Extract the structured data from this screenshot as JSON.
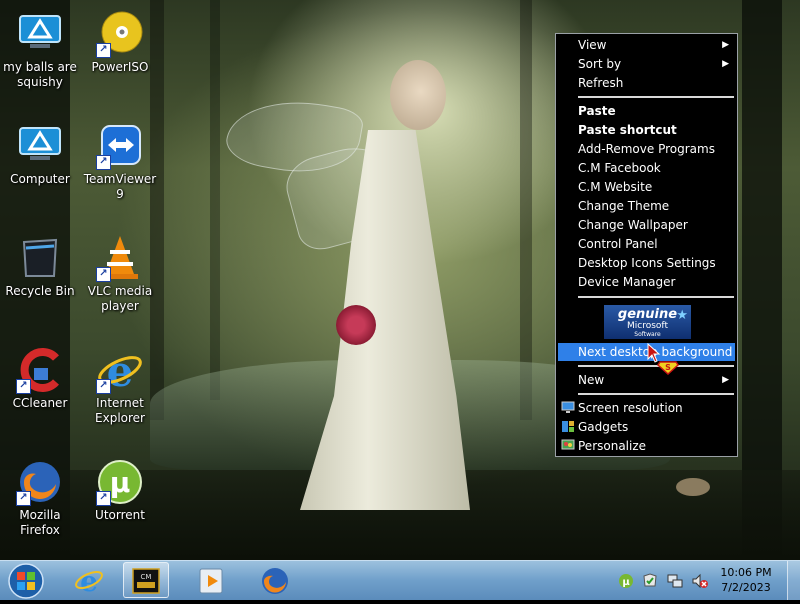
{
  "desktop": {
    "icons": [
      {
        "label": "my balls are squishy",
        "icon": "network-icon"
      },
      {
        "label": "PowerISO",
        "icon": "poweriso-disc-icon"
      },
      {
        "label": "Computer",
        "icon": "computer-icon"
      },
      {
        "label": "TeamViewer 9",
        "icon": "teamviewer-icon"
      },
      {
        "label": "Recycle Bin",
        "icon": "recycle-bin-icon"
      },
      {
        "label": "VLC media player",
        "icon": "vlc-cone-icon"
      },
      {
        "label": "CCleaner",
        "icon": "ccleaner-icon"
      },
      {
        "label": "Internet Explorer",
        "icon": "internet-explorer-icon"
      },
      {
        "label": "Mozilla Firefox",
        "icon": "firefox-icon"
      },
      {
        "label": "Utorrent",
        "icon": "utorrent-icon"
      }
    ]
  },
  "context_menu": {
    "items": [
      {
        "label": "View",
        "submenu": true
      },
      {
        "label": "Sort by",
        "submenu": true
      },
      {
        "label": "Refresh"
      },
      {
        "label": "Paste"
      },
      {
        "label": "Paste shortcut"
      },
      {
        "label": "Add-Remove Programs"
      },
      {
        "label": "C.M Facebook"
      },
      {
        "label": "C.M Website"
      },
      {
        "label": "Change Theme"
      },
      {
        "label": "Change Wallpaper"
      },
      {
        "label": "Control Panel"
      },
      {
        "label": "Desktop Icons Settings"
      },
      {
        "label": "Device Manager"
      },
      {
        "label": "Next desktop background",
        "highlighted": true
      },
      {
        "label": "New",
        "submenu": true
      },
      {
        "label": "Screen resolution",
        "icon": "monitor-icon"
      },
      {
        "label": "Gadgets",
        "icon": "gadgets-icon"
      },
      {
        "label": "Personalize",
        "icon": "personalize-icon"
      }
    ],
    "banner": {
      "line1": "genuine",
      "line2": "Microsoft",
      "line3": "Software"
    }
  },
  "taskbar": {
    "buttons": [
      "start-orb-icon",
      "internet-explorer-icon",
      "cm-app-icon",
      "media-player-icon",
      "firefox-icon"
    ],
    "clock": {
      "time": "10:06 PM",
      "date": "7/2/2023"
    },
    "colors": {
      "accent": "#2f80e8",
      "taskbar": "#6f9fca"
    }
  }
}
